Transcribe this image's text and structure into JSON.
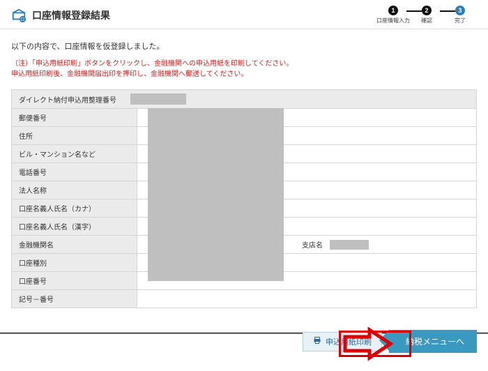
{
  "header": {
    "title": "口座情報登録結果",
    "steps": [
      {
        "num": "1",
        "label": "口座情報入力"
      },
      {
        "num": "2",
        "label": "確認"
      },
      {
        "num": "3",
        "label": "完了"
      }
    ]
  },
  "intro": "以下の内容で、口座情報を仮登録しました。",
  "note_line1": "（注）「申込用紙印刷」ボタンをクリックし、金融機関への申込用紙を印刷してください。",
  "note_line2": "申込用紙印刷後、金融機関届出印を押印し、金融機関へ郵送してください。",
  "number_row": {
    "label": "ダイレクト納付申込用整理番号"
  },
  "rows": [
    {
      "label": "郵便番号"
    },
    {
      "label": "住所"
    },
    {
      "label": "ビル・マンション名など"
    },
    {
      "label": "電話番号"
    },
    {
      "label": "法人名称"
    },
    {
      "label": "口座名義人氏名（カナ）"
    },
    {
      "label": "口座名義人氏名（漢字）"
    },
    {
      "label": "金融機関名",
      "branch_label": "支店名"
    },
    {
      "label": "口座種別"
    },
    {
      "label": "口座番号"
    },
    {
      "label": "記号－番号"
    }
  ],
  "footer": {
    "print": "申込用紙印刷",
    "next": "納税メニューへ"
  }
}
